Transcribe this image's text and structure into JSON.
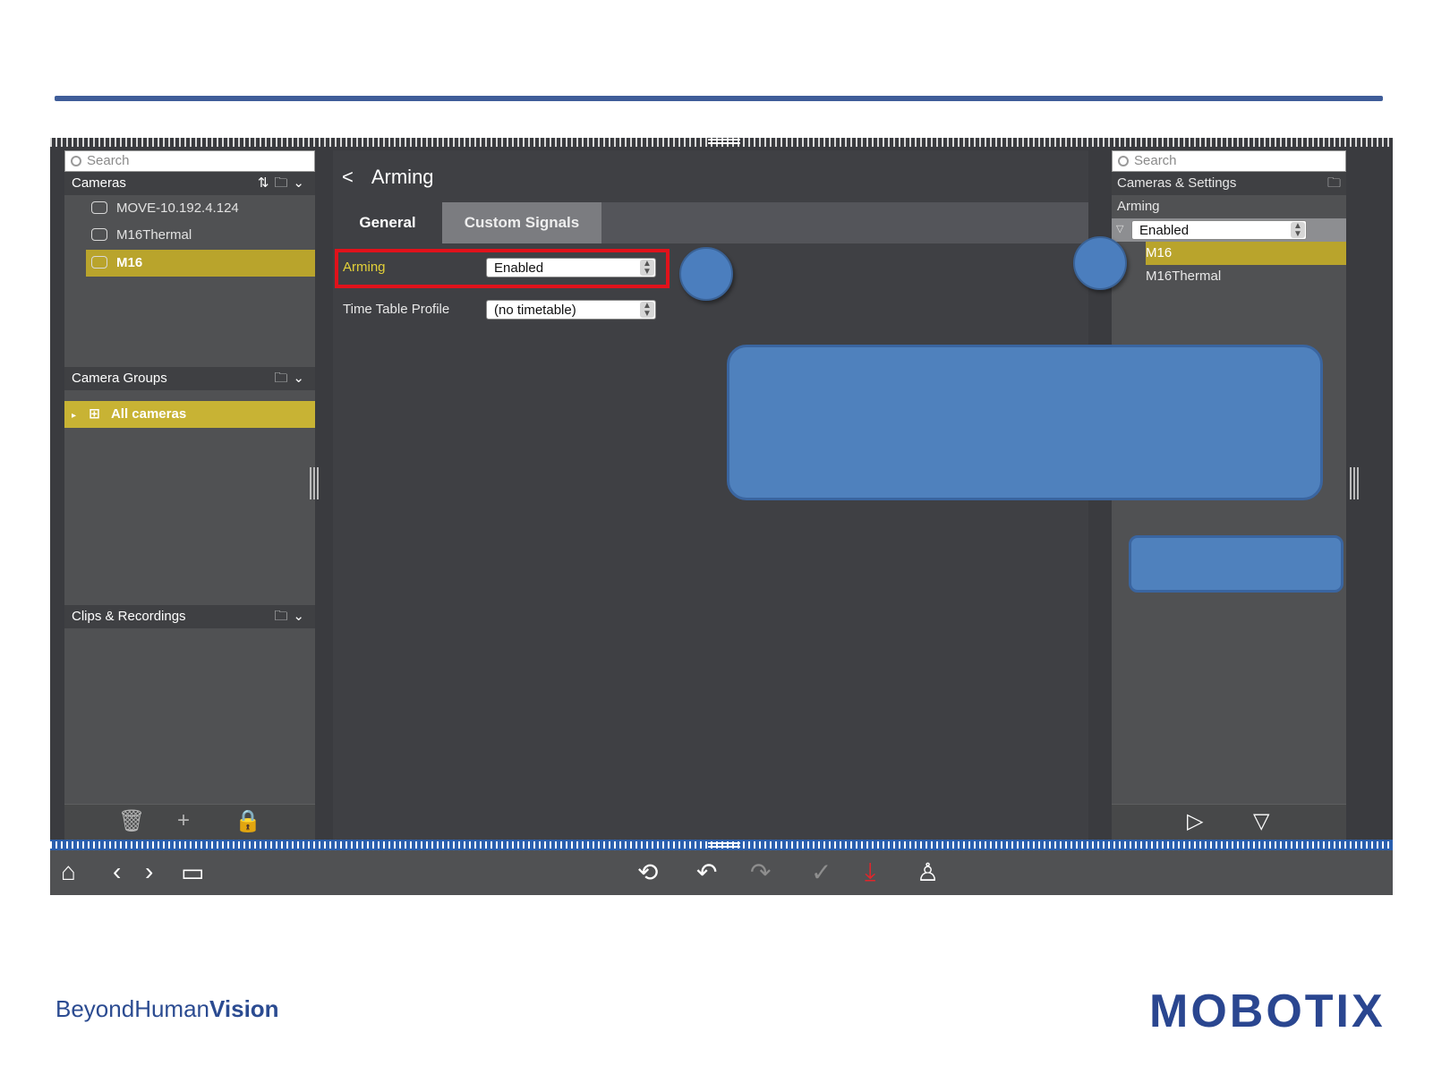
{
  "left_panel": {
    "search_placeholder": "Search",
    "cameras_label": "Cameras",
    "cameras": [
      {
        "name": "MOVE-10.192.4.124"
      },
      {
        "name": "M16Thermal"
      },
      {
        "name": "M16"
      }
    ],
    "camera_groups_label": "Camera Groups",
    "group_all": "All cameras",
    "clips_label": "Clips & Recordings"
  },
  "center": {
    "title": "Arming",
    "tabs": [
      "General",
      "Custom Signals"
    ],
    "arming_label": "Arming",
    "arming_value": "Enabled",
    "time_table_label": "Time Table Profile",
    "time_table_value": "(no timetable)"
  },
  "right_panel": {
    "search_placeholder": "Search",
    "header": "Cameras & Settings",
    "section": "Arming",
    "selected_value": "Enabled",
    "items": [
      "M16",
      "M16Thermal"
    ]
  },
  "footer": {
    "brand_left_1": "Beyond",
    "brand_left_2": "Human",
    "brand_left_3": "Vision",
    "brand_right": "MOBOTIX"
  },
  "colors": {
    "accent_blue": "#3f5d99",
    "selection_yellow": "#c8b334",
    "highlight_red": "#e0121b",
    "callout_blue": "#4f81bd"
  }
}
